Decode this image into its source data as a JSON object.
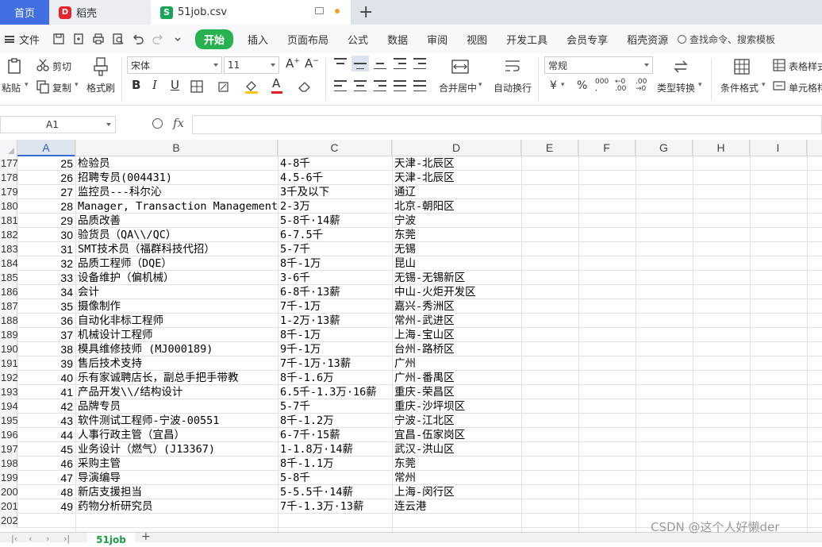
{
  "tabs": {
    "home": "首页",
    "daoke": "稻壳",
    "daoke_logo": "D",
    "file": "51job.csv",
    "file_logo": "S"
  },
  "menubar": {
    "file_menu": "文件",
    "items": [
      "开始",
      "插入",
      "页面布局",
      "公式",
      "数据",
      "审阅",
      "视图",
      "开发工具",
      "会员专享",
      "稻壳资源"
    ],
    "search": "查找命令、搜索模板"
  },
  "ribbon": {
    "paste": "粘贴",
    "cut": "剪切",
    "copy": "复制",
    "format_painter": "格式刷",
    "font_name": "宋体",
    "font_size": "11",
    "merge_center": "合并居中",
    "wrap_text": "自动换行",
    "number_format": "常规",
    "currency_symbol": "¥",
    "percent_symbol": "%",
    "type_convert": "类型转换",
    "cond_format": "条件格式",
    "table_style": "表格样式",
    "cell_style": "单元格样式"
  },
  "formula_bar": {
    "cell_ref": "A1",
    "fx": "fx",
    "content": ""
  },
  "columns": [
    "A",
    "B",
    "C",
    "D",
    "E",
    "F",
    "G",
    "H",
    "I"
  ],
  "rows": [
    {
      "num": "177",
      "a": "25",
      "b": "检验员",
      "c": "4-8千",
      "d": "天津-北辰区"
    },
    {
      "num": "178",
      "a": "26",
      "b": "招聘专员(004431)",
      "c": "4.5-6千",
      "d": "天津-北辰区"
    },
    {
      "num": "179",
      "a": "27",
      "b": "监控员---科尔沁",
      "c": "3千及以下",
      "d": "通辽"
    },
    {
      "num": "180",
      "a": "28",
      "b": "Manager, Transaction Management",
      "c": "2-3万",
      "d": "北京-朝阳区"
    },
    {
      "num": "181",
      "a": "29",
      "b": "品质改善",
      "c": "5-8千·14薪",
      "d": "宁波"
    },
    {
      "num": "182",
      "a": "30",
      "b": "验货员（QA\\\\/QC）",
      "c": "6-7.5千",
      "d": "东莞"
    },
    {
      "num": "183",
      "a": "31",
      "b": "SMT技术员（福群科技代招）",
      "c": "5-7千",
      "d": "无锡"
    },
    {
      "num": "184",
      "a": "32",
      "b": "品质工程师（DQE）",
      "c": "8千-1万",
      "d": "昆山"
    },
    {
      "num": "185",
      "a": "33",
      "b": "设备维护（偏机械）",
      "c": "3-6千",
      "d": "无锡-无锡新区"
    },
    {
      "num": "186",
      "a": "34",
      "b": "会计",
      "c": "6-8千·13薪",
      "d": "中山-火炬开发区"
    },
    {
      "num": "187",
      "a": "35",
      "b": "摄像制作",
      "c": "7千-1万",
      "d": "嘉兴-秀洲区"
    },
    {
      "num": "188",
      "a": "36",
      "b": "自动化非标工程师",
      "c": "1-2万·13薪",
      "d": "常州-武进区"
    },
    {
      "num": "189",
      "a": "37",
      "b": "机械设计工程师",
      "c": "8千-1万",
      "d": "上海-宝山区"
    },
    {
      "num": "190",
      "a": "38",
      "b": "模具维修技师 (MJ000189)",
      "c": "9千-1万",
      "d": "台州-路桥区"
    },
    {
      "num": "191",
      "a": "39",
      "b": "售后技术支持",
      "c": "7千-1万·13薪",
      "d": "广州"
    },
    {
      "num": "192",
      "a": "40",
      "b": "乐有家诚聘店长，副总手把手带教",
      "c": "8千-1.6万",
      "d": "广州-番禺区"
    },
    {
      "num": "193",
      "a": "41",
      "b": "产品开发\\\\/结构设计",
      "c": "6.5千-1.3万·16薪",
      "d": "重庆-荣昌区"
    },
    {
      "num": "194",
      "a": "42",
      "b": "品牌专员",
      "c": "5-7千",
      "d": "重庆-沙坪坝区"
    },
    {
      "num": "195",
      "a": "43",
      "b": "软件测试工程师-宁波-00551",
      "c": "8千-1.2万",
      "d": "宁波-江北区"
    },
    {
      "num": "196",
      "a": "44",
      "b": "人事行政主管（宜昌）",
      "c": "6-7千·15薪",
      "d": "宜昌-伍家岗区"
    },
    {
      "num": "197",
      "a": "45",
      "b": "业务设计（燃气）(J13367)",
      "c": "1-1.8万·14薪",
      "d": "武汉-洪山区"
    },
    {
      "num": "198",
      "a": "46",
      "b": "采购主管",
      "c": "8千-1.1万",
      "d": "东莞"
    },
    {
      "num": "199",
      "a": "47",
      "b": "导演编导",
      "c": "5-8千",
      "d": "常州"
    },
    {
      "num": "200",
      "a": "48",
      "b": "新店支援担当",
      "c": "5-5.5千·14薪",
      "d": "上海-闵行区"
    },
    {
      "num": "201",
      "a": "49",
      "b": "药物分析研究员",
      "c": "7千-1.3万·13薪",
      "d": "连云港"
    },
    {
      "num": "202",
      "a": "",
      "b": "",
      "c": "",
      "d": ""
    }
  ],
  "sheet_tab": "51job",
  "watermark": "CSDN @这个人好懒der"
}
